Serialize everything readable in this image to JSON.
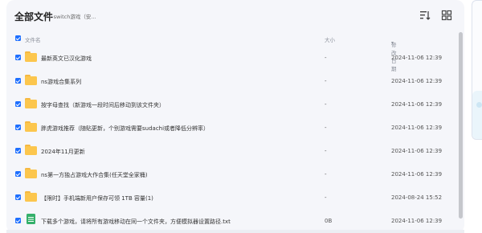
{
  "header": {
    "title": "全部文件",
    "breadcrumb": "switch游戏（安..."
  },
  "columns": {
    "name": "文件名",
    "size": "大小",
    "date": "修改日期"
  },
  "rows": [
    {
      "name": "最新英文已汉化游戏",
      "size": "-",
      "date": "2024-11-06 12:39",
      "type": "folder"
    },
    {
      "name": "ns游戏合集系列",
      "size": "-",
      "date": "2024-11-06 12:39",
      "type": "folder"
    },
    {
      "name": "按字母查找（新游戏一段时间后移动到该文件夹）",
      "size": "-",
      "date": "2024-11-06 12:39",
      "type": "folder"
    },
    {
      "name": "胖虎游戏推荐（随贴更新，个别游戏需要sudachi或者降低分辨率）",
      "size": "-",
      "date": "2024-11-06 12:39",
      "type": "folder"
    },
    {
      "name": "2024年11月更新",
      "size": "-",
      "date": "2024-11-06 12:39",
      "type": "folder"
    },
    {
      "name": "ns第一方独占游戏大作合集(任天堂全家桶)",
      "size": "-",
      "date": "2024-11-06 12:39",
      "type": "folder"
    },
    {
      "name": "【限时】手机端新用户保存可领 1TB 容量(1)",
      "size": "-",
      "date": "2024-08-24 15:52",
      "type": "folder"
    },
    {
      "name": "下载多个游戏，请将所有游戏移动在同一个文件夹，方便模拟器设置路径.txt",
      "size": "0B",
      "date": "2024-11-06 12:39",
      "type": "txt"
    }
  ],
  "colors": {
    "accent": "#1e6fff",
    "folder": "#fcc64d",
    "txt": "#35b06b",
    "panel_bg": "#f5f6fa"
  },
  "icons": [
    "sort-icon",
    "grid-view-icon",
    "folder-icon",
    "txt-file-icon",
    "checkbox-icon",
    "sort-desc-icon"
  ]
}
